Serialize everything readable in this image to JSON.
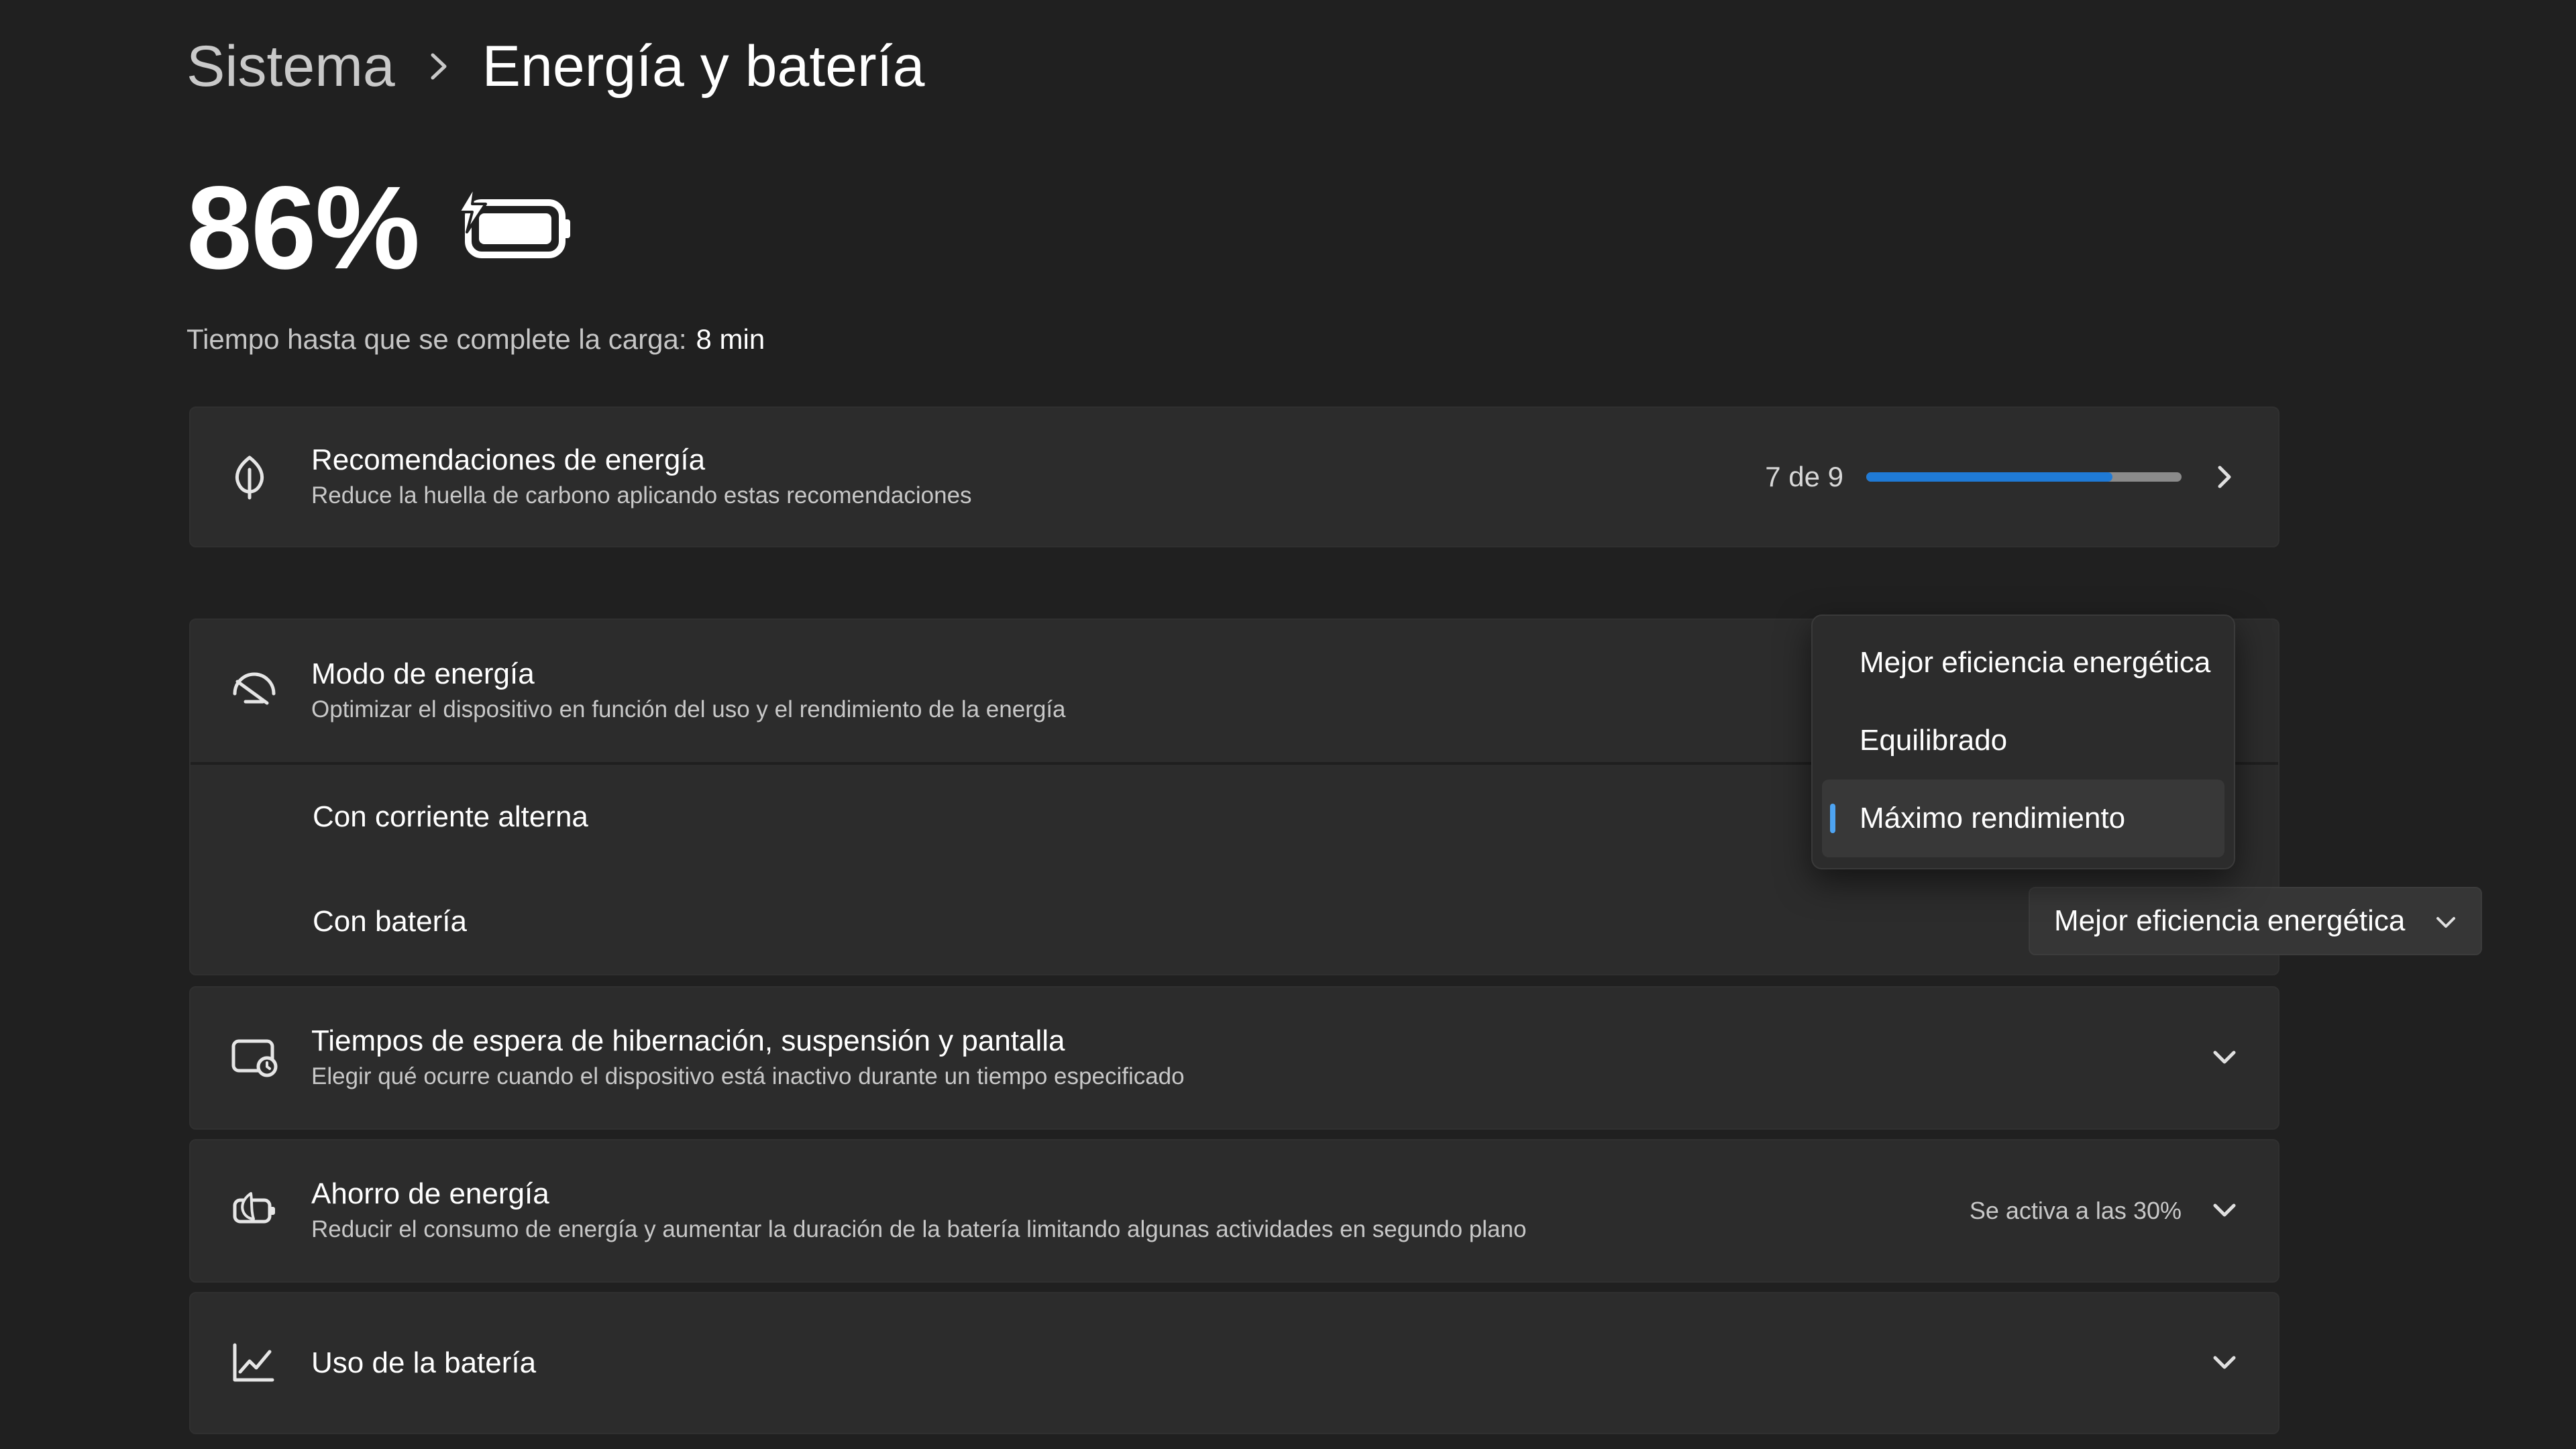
{
  "breadcrumb": {
    "parent": "Sistema",
    "current": "Energía y batería"
  },
  "battery": {
    "percent": "86%",
    "charging": true,
    "charge_time_label": "Tiempo hasta que se complete la carga:",
    "charge_time_value": "8 min"
  },
  "colors": {
    "background": "#202020",
    "card": "#2c2c2c",
    "accent": "#1f7ad6",
    "indicator": "#4ea4f2"
  },
  "recommendations": {
    "icon": "leaf-icon",
    "title": "Recomendaciones de energía",
    "subtitle": "Reduce la huella de carbono aplicando estas recomendaciones",
    "progress_text": "7 de 9",
    "progress_value": 0.78
  },
  "power_mode": {
    "icon": "gauge-icon",
    "title": "Modo de energía",
    "subtitle": "Optimizar el dispositivo en función del uso y el rendimiento de la energía",
    "ac_label": "Con corriente alterna",
    "battery_label": "Con batería",
    "battery_selected": "Mejor eficiencia energética",
    "menu_options": [
      "Mejor eficiencia energética",
      "Equilibrado",
      "Máximo rendimiento"
    ],
    "menu_selected": "Máximo rendimiento"
  },
  "timeouts": {
    "icon": "screen-sleep-icon",
    "title": "Tiempos de espera de hibernación, suspensión y pantalla",
    "subtitle": "Elegir qué ocurre cuando el dispositivo está inactivo durante un tiempo especificado"
  },
  "energy_saver": {
    "icon": "battery-saver-icon",
    "title": "Ahorro de energía",
    "subtitle": "Reducir el consumo de energía y aumentar la duración de la batería limitando algunas actividades en segundo plano",
    "status": "Se activa a las 30%"
  },
  "battery_usage": {
    "icon": "line-chart-icon",
    "title": "Uso de la batería"
  }
}
